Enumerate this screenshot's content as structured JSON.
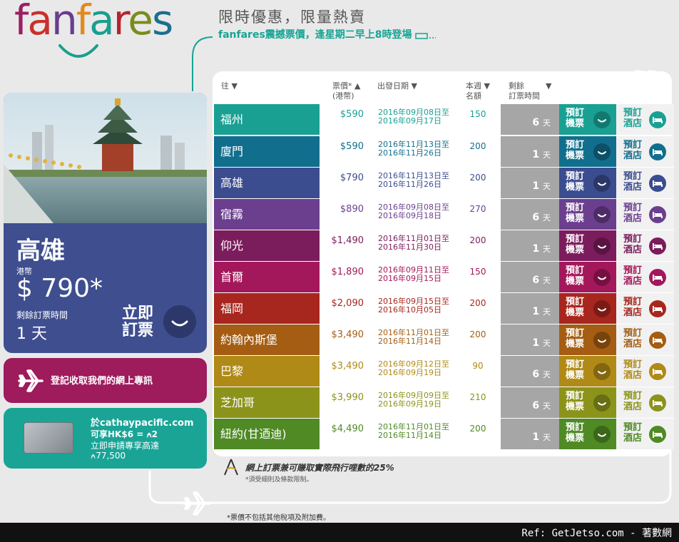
{
  "brand": {
    "logo_parts": [
      {
        "text": "f",
        "color": "#9b1e63"
      },
      {
        "text": "a",
        "color": "#c9302c"
      },
      {
        "text": "n",
        "color": "#6a3d8f"
      },
      {
        "text": "f",
        "color": "#e08a1e"
      },
      {
        "text": "a",
        "color": "#1a9e8f"
      },
      {
        "text": "r",
        "color": "#b5232d"
      },
      {
        "text": "e",
        "color": "#7a8c1e"
      },
      {
        "text": "s",
        "color": "#1c6e8e"
      }
    ]
  },
  "header": {
    "title": "限時優惠，限量熱賣",
    "subtitle_brand": "fanfares",
    "subtitle_rest": "震撼票價，逢星期二早上8時登場"
  },
  "featured": {
    "city": "高雄",
    "currency": "港幣",
    "price": "$ 790*",
    "remain_label": "剩餘訂票時間",
    "remain_value": "1 天",
    "book_label_1": "立即",
    "book_label_2": "訂票"
  },
  "newsletter": {
    "text": "登記收取我們的網上專訊"
  },
  "card_promo": {
    "line1": "於cathaypacific.com",
    "line2": "可享HK$6 = ⍲2",
    "line3": "立即申請專享高達",
    "line4": "⍲77,500"
  },
  "columns": {
    "destination": "往 ▼",
    "fare_1": "票價* ▲",
    "fare_2": "(港幣)",
    "dates": "出發日期 ▼",
    "seats_1": "本週 ▼",
    "seats_2": "名額",
    "remain_1": "剩餘",
    "remain_2": "訂票時間",
    "remain_arrow": "▼"
  },
  "row_labels": {
    "flight_1": "預訂",
    "flight_2": "機票",
    "hotel_1": "預訂",
    "hotel_2": "酒店",
    "day_unit": "天"
  },
  "fares": [
    {
      "destination": "福州",
      "price": "$590",
      "date_from": "2016年09月08日至",
      "date_to": "2016年09月17日",
      "seats": "150",
      "remain": "6",
      "color": "#1aa093",
      "dark": "#117a70"
    },
    {
      "destination": "廈門",
      "price": "$590",
      "date_from": "2016年11月13日至",
      "date_to": "2016年11月26日",
      "seats": "200",
      "remain": "1",
      "color": "#126e8d",
      "dark": "#0c4f66"
    },
    {
      "destination": "高雄",
      "price": "$790",
      "date_from": "2016年11月13日至",
      "date_to": "2016年11月26日",
      "seats": "200",
      "remain": "1",
      "color": "#3b4d8f",
      "dark": "#2a3768"
    },
    {
      "destination": "宿霧",
      "price": "$890",
      "date_from": "2016年09月08日至",
      "date_to": "2016年09月18日",
      "seats": "270",
      "remain": "6",
      "color": "#6b3f8e",
      "dark": "#4d2c67"
    },
    {
      "destination": "仰光",
      "price": "$1,490",
      "date_from": "2016年11月01日至",
      "date_to": "2016年11月30日",
      "seats": "200",
      "remain": "1",
      "color": "#7b1c5c",
      "dark": "#591443"
    },
    {
      "destination": "首爾",
      "price": "$1,890",
      "date_from": "2016年09月11日至",
      "date_to": "2016年09月15日",
      "seats": "150",
      "remain": "6",
      "color": "#a3185a",
      "dark": "#761042"
    },
    {
      "destination": "福岡",
      "price": "$2,090",
      "date_from": "2016年09月15日至",
      "date_to": "2016年10月05日",
      "seats": "200",
      "remain": "1",
      "color": "#a7261e",
      "dark": "#7a1b15"
    },
    {
      "destination": "約翰內斯堡",
      "price": "$3,490",
      "date_from": "2016年11月01日至",
      "date_to": "2016年11月14日",
      "seats": "200",
      "remain": "1",
      "color": "#a45d12",
      "dark": "#78430c"
    },
    {
      "destination": "巴黎",
      "price": "$3,490",
      "date_from": "2016年09月12日至",
      "date_to": "2016年09月19日",
      "seats": "90",
      "remain": "6",
      "color": "#b08a16",
      "dark": "#836610"
    },
    {
      "destination": "芝加哥",
      "price": "$3,990",
      "date_from": "2016年09月09日至",
      "date_to": "2016年09月19日",
      "seats": "210",
      "remain": "6",
      "color": "#8c931a",
      "dark": "#686e12"
    },
    {
      "destination": "紐約(甘迺迪)",
      "price": "$4,490",
      "date_from": "2016年11月01日至",
      "date_to": "2016年11月14日",
      "seats": "200",
      "remain": "1",
      "color": "#4f8a25",
      "dark": "#3a671a"
    }
  ],
  "miles": {
    "text": "網上訂票兼可賺取實際飛行哩數的25%",
    "note": "*須受細則及條款限制。"
  },
  "footnote": "*票價不包括其他稅項及附加費。",
  "bottom_bar": {
    "ref": "Ref: GetJetso.com - 著數網"
  }
}
